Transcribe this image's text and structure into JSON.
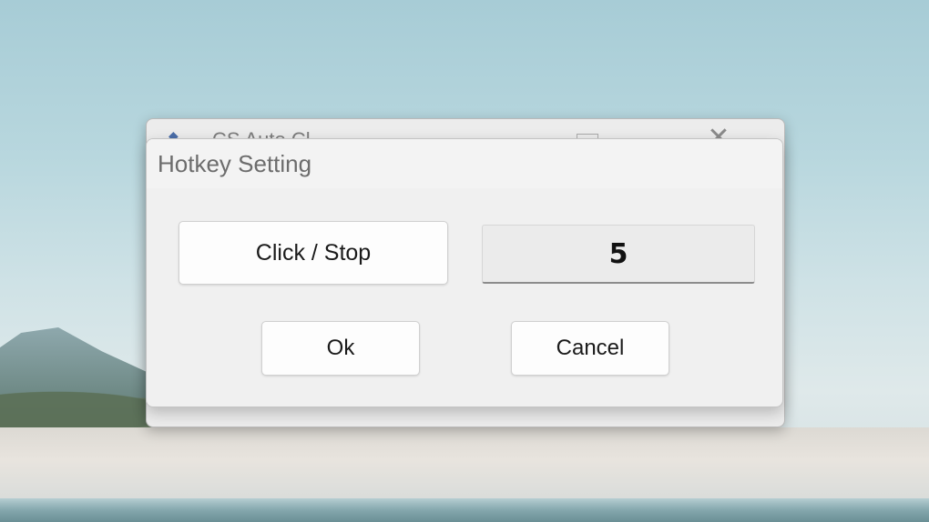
{
  "parent_window": {
    "title": "CS Auto Cl",
    "app_icon": "app-icon",
    "maximize_icon": "maximize-icon",
    "close_icon": "close-icon",
    "close_glyph": "✕"
  },
  "dialog": {
    "title": "Hotkey Setting",
    "action_button_label": "Click / Stop",
    "hotkey_value": "5",
    "ok_label": "Ok",
    "cancel_label": "Cancel"
  }
}
